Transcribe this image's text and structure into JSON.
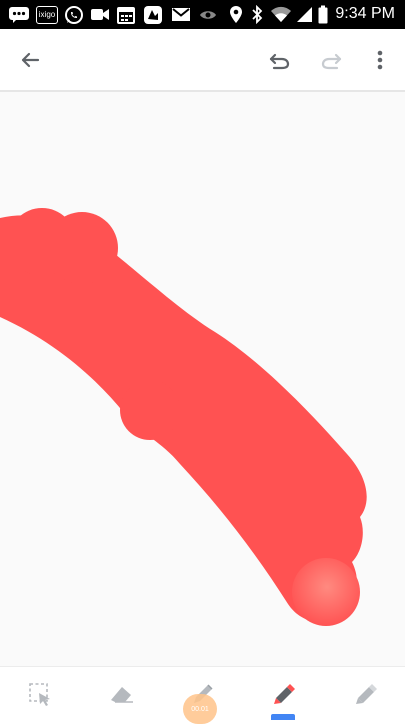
{
  "status_bar": {
    "time": "9:34 PM",
    "icons": [
      "messages-icon",
      "ixigo-app-icon",
      "whatsapp-icon",
      "video-camera-icon",
      "calendar-icon",
      "photo-app-icon",
      "gmail-icon",
      "eye-icon",
      "location-icon",
      "bluetooth-icon",
      "wifi-icon",
      "battery-icon"
    ],
    "ixigo_label": "ixigo"
  },
  "app_bar": {
    "icons": [
      "back-arrow-icon",
      "undo-icon",
      "redo-icon",
      "more-vertical-icon"
    ],
    "redo_enabled": false
  },
  "canvas": {
    "background": "#fafafa",
    "stroke_color": "#ff5252",
    "stroke_count": 1
  },
  "toolbar": {
    "tools": [
      "selection-tool",
      "eraser-tool",
      "pen-tool",
      "marker-tool",
      "highlighter-tool"
    ],
    "active_tool": "marker-tool",
    "active_color": "#ff5252",
    "indicator_color": "#4285f4",
    "size_bubble_label": "00.01"
  }
}
